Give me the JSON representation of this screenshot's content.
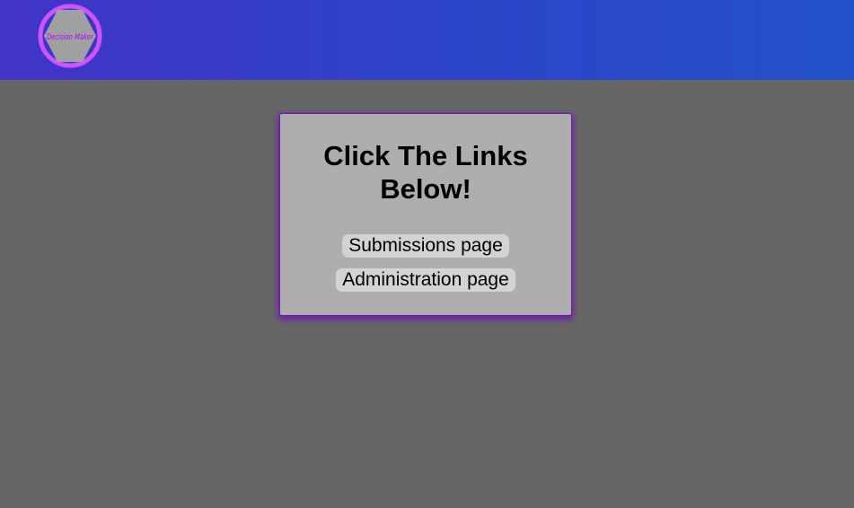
{
  "header": {
    "logo_text": "Decision Maker"
  },
  "card": {
    "title": "Click The Links Below!",
    "links": [
      {
        "label": "Submissions page"
      },
      {
        "label": "Administration page"
      }
    ]
  },
  "colors": {
    "header_gradient_start": "#4333c8",
    "header_gradient_end": "#2350ca",
    "page_background": "#666666",
    "card_background": "#aeaeae",
    "card_border": "#7a10b8",
    "logo_ring": "#cc55ff",
    "logo_hexagon": "#a0a0a0",
    "logo_text": "#b000ff",
    "link_background": "#d3d3d3"
  }
}
